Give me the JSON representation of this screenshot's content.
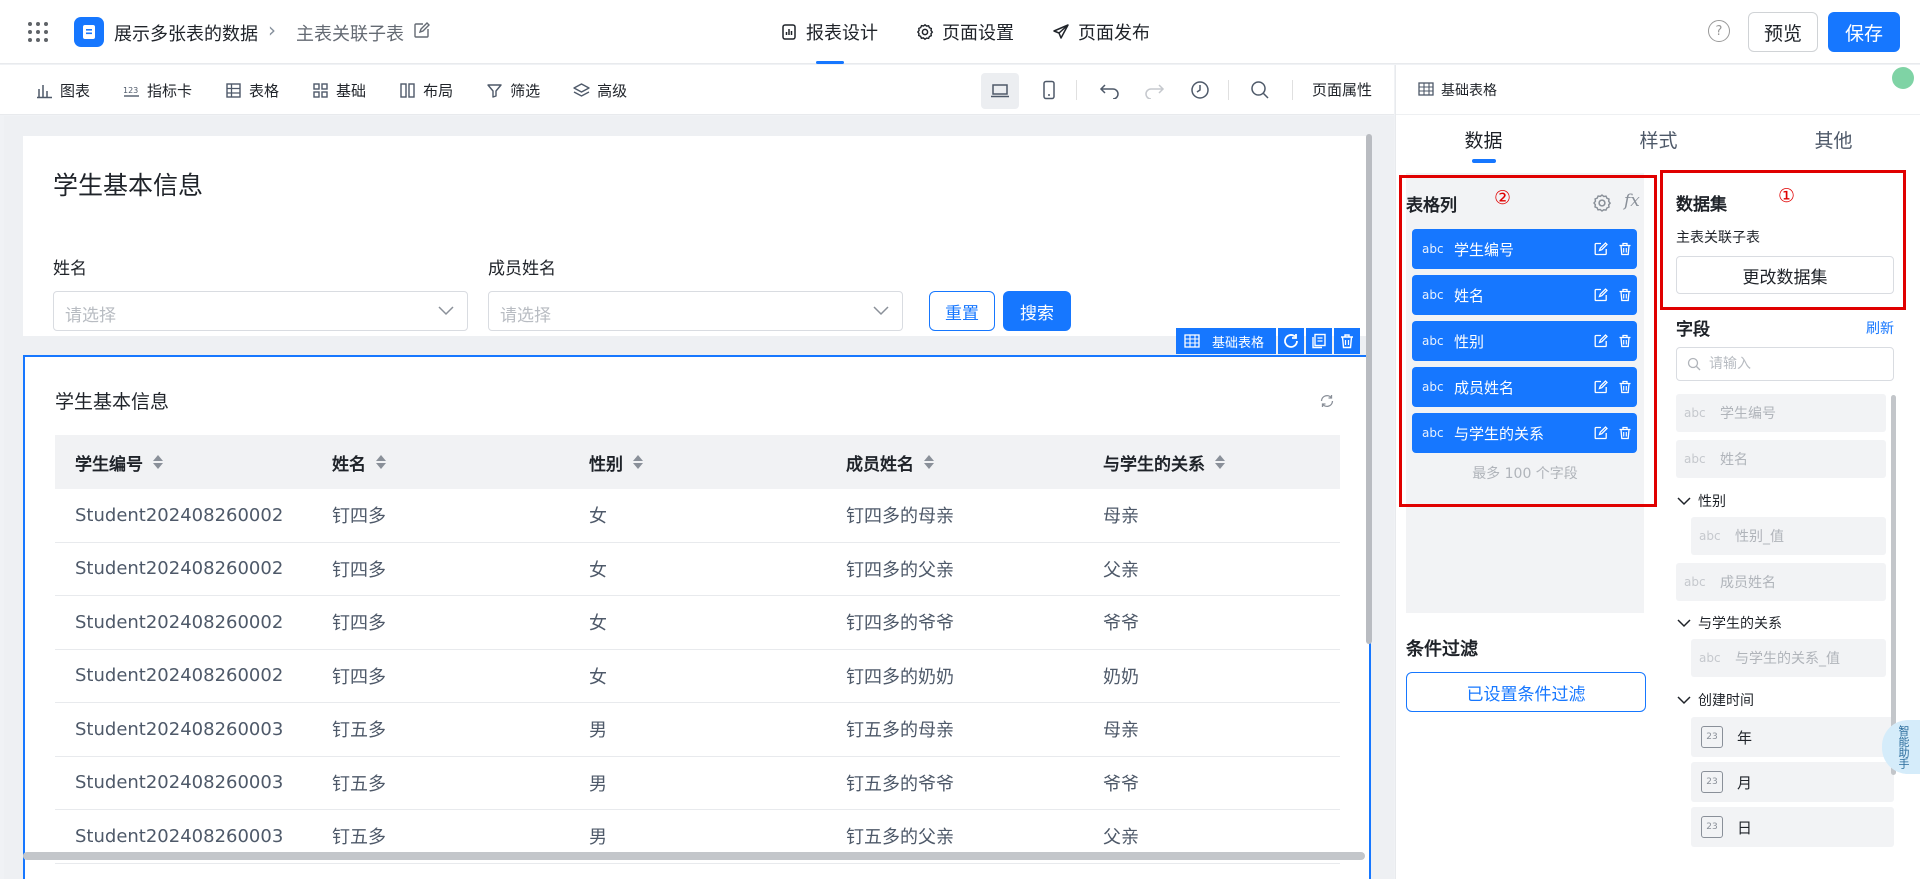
{
  "header": {
    "app_name": "展示多张表的数据",
    "page_name": "主表关联子表",
    "tabs": [
      {
        "label": "报表设计",
        "icon": "report-icon"
      },
      {
        "label": "页面设置",
        "icon": "gear-icon"
      },
      {
        "label": "页面发布",
        "icon": "send-icon"
      }
    ],
    "help_label": "?",
    "preview_label": "预览",
    "save_label": "保存"
  },
  "toolbar": {
    "items": [
      {
        "label": "图表",
        "icon": "chart-icon"
      },
      {
        "label": "指标卡",
        "icon": "metric-icon"
      },
      {
        "label": "表格",
        "icon": "table-icon"
      },
      {
        "label": "基础",
        "icon": "grid-icon"
      },
      {
        "label": "布局",
        "icon": "layout-icon"
      },
      {
        "label": "筛选",
        "icon": "filter-icon"
      },
      {
        "label": "高级",
        "icon": "layers-icon"
      }
    ],
    "page_props": "页面属性"
  },
  "filter_card": {
    "title": "学生基本信息",
    "filters": [
      {
        "label": "姓名",
        "placeholder": "请选择"
      },
      {
        "label": "成员姓名",
        "placeholder": "请选择"
      }
    ],
    "reset_label": "重置",
    "search_label": "搜索"
  },
  "component_tag": {
    "label": "基础表格"
  },
  "table": {
    "title": "学生基本信息",
    "columns": [
      "学生编号",
      "姓名",
      "性别",
      "成员姓名",
      "与学生的关系"
    ],
    "rows": [
      [
        "Student202408260002",
        "钉四多",
        "女",
        "钉四多的母亲",
        "母亲"
      ],
      [
        "Student202408260002",
        "钉四多",
        "女",
        "钉四多的父亲",
        "父亲"
      ],
      [
        "Student202408260002",
        "钉四多",
        "女",
        "钉四多的爷爷",
        "爷爷"
      ],
      [
        "Student202408260002",
        "钉四多",
        "女",
        "钉四多的奶奶",
        "奶奶"
      ],
      [
        "Student202408260003",
        "钉五多",
        "男",
        "钉五多的母亲",
        "母亲"
      ],
      [
        "Student202408260003",
        "钉五多",
        "男",
        "钉五多的爷爷",
        "爷爷"
      ],
      [
        "Student202408260003",
        "钉五多",
        "男",
        "钉五多的父亲",
        "父亲"
      ]
    ]
  },
  "right_panel": {
    "header_title": "基础表格",
    "tabs": [
      "数据",
      "样式",
      "其他"
    ],
    "columns_section": {
      "title": "表格列",
      "marker": "②",
      "fx_label": "fx",
      "fields": [
        {
          "type": "abc",
          "name": "学生编号"
        },
        {
          "type": "abc",
          "name": "姓名"
        },
        {
          "type": "abc",
          "name": "性别"
        },
        {
          "type": "abc",
          "name": "成员姓名"
        },
        {
          "type": "abc",
          "name": "与学生的关系"
        }
      ],
      "max_note": "最多 100 个字段"
    },
    "condition_filter": {
      "title": "条件过滤",
      "button_label": "已设置条件过滤"
    },
    "dataset_section": {
      "title": "数据集",
      "marker": "①",
      "dataset_name": "主表关联子表",
      "change_label": "更改数据集"
    },
    "fields_section": {
      "title": "字段",
      "refresh_label": "刷新",
      "search_placeholder": "请输入",
      "items": [
        {
          "type": "abc",
          "name": "学生编号"
        },
        {
          "type": "abc",
          "name": "姓名"
        }
      ],
      "group_gender": "性别",
      "gender_value": {
        "type": "abc",
        "name": "性别_值"
      },
      "member_name": {
        "type": "abc",
        "name": "成员姓名"
      },
      "group_relation": "与学生的关系",
      "relation_value": {
        "type": "abc",
        "name": "与学生的关系_值"
      },
      "group_created": "创建时间",
      "date_parts": [
        {
          "icon": "calendar-icon",
          "icon_text": "23",
          "name": "年"
        },
        {
          "icon": "calendar-icon",
          "icon_text": "23",
          "name": "月"
        },
        {
          "icon": "calendar-icon",
          "icon_text": "23",
          "name": "日"
        }
      ]
    },
    "float_badge": "智能助手"
  },
  "colors": {
    "accent": "#1677ff",
    "annotation_red": "#e00000"
  }
}
